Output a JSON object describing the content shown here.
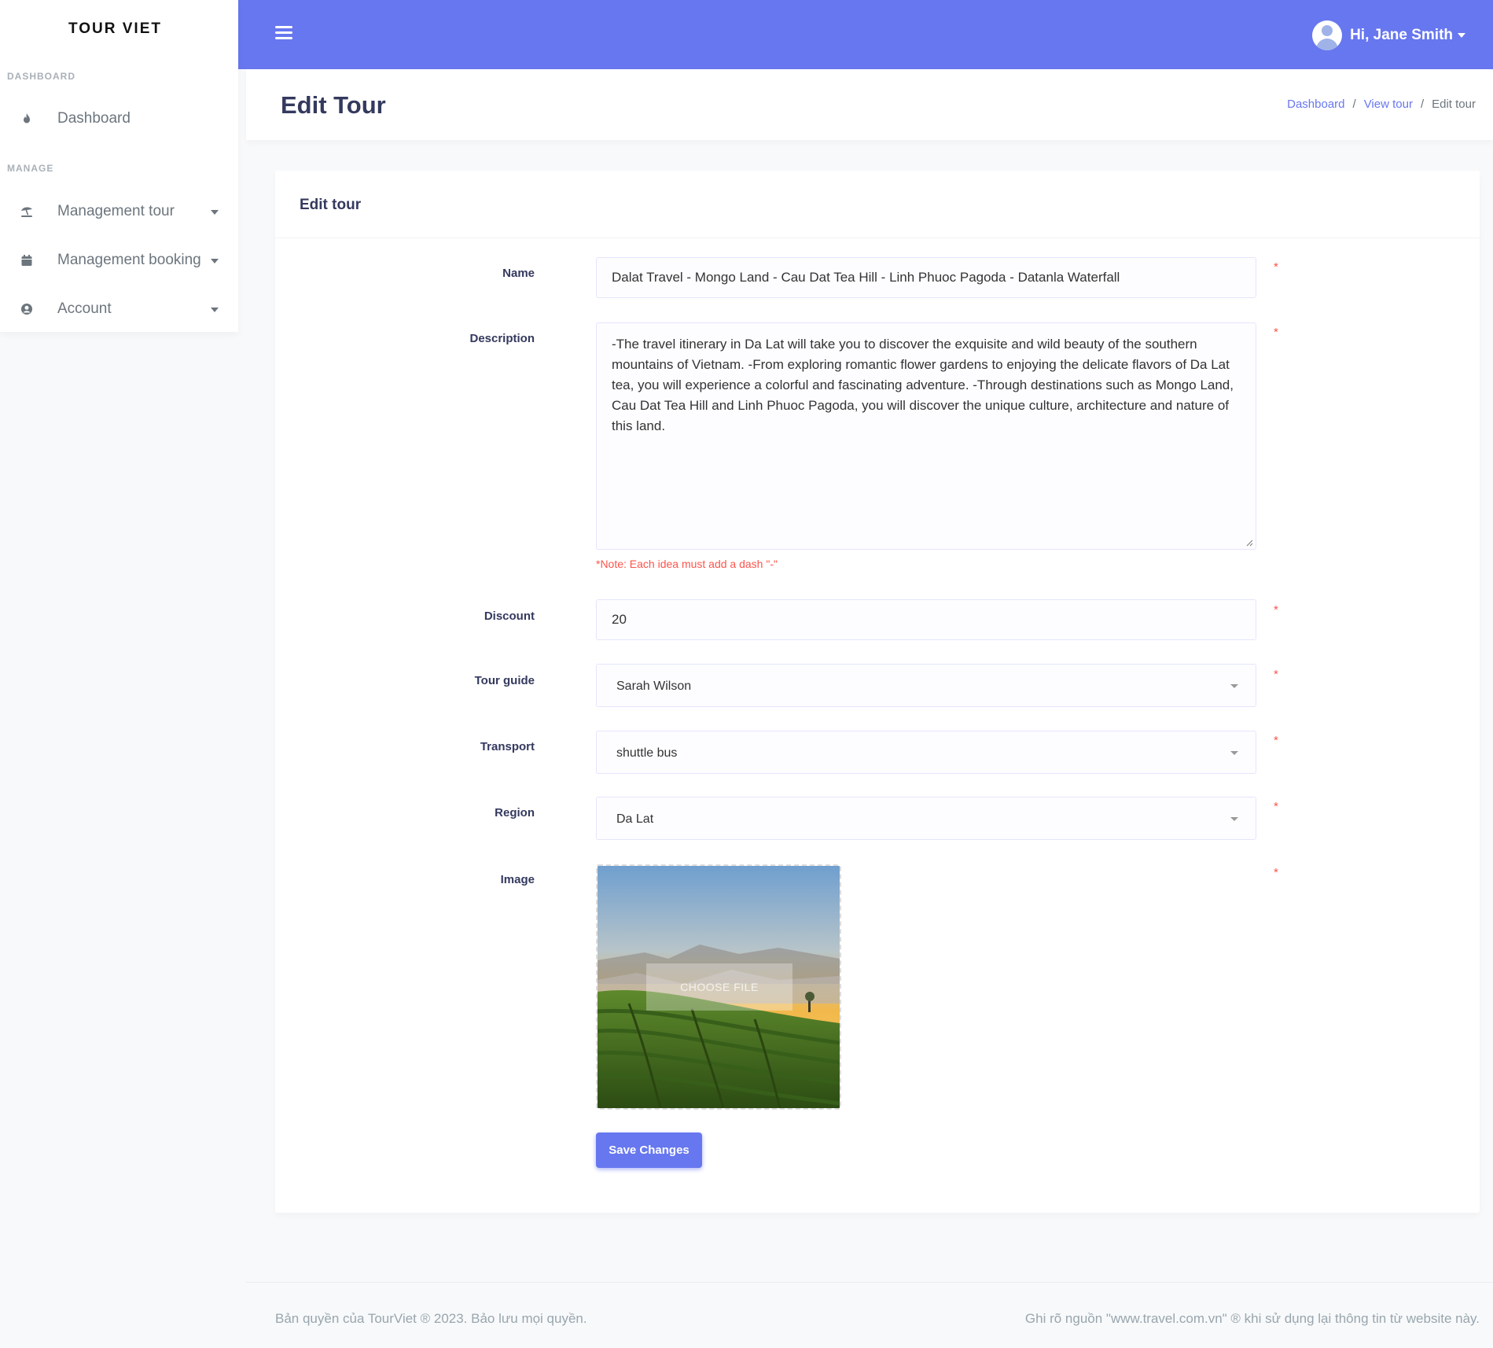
{
  "topbar": {
    "user_greeting": "Hi, Jane Smith"
  },
  "sidebar": {
    "brand": "TOUR VIET",
    "headers": [
      "DASHBOARD",
      "MANAGE"
    ],
    "items": [
      {
        "label": "Dashboard",
        "icon": "fire-icon"
      },
      {
        "label": "Management tour",
        "icon": "beach-umbrella-icon"
      },
      {
        "label": "Management booking",
        "icon": "calendar-icon"
      },
      {
        "label": "Account",
        "icon": "user-circle-icon"
      }
    ]
  },
  "page": {
    "title": "Edit Tour",
    "breadcrumb": [
      "Dashboard",
      "View tour",
      "Edit tour"
    ]
  },
  "card": {
    "title": "Edit tour"
  },
  "form": {
    "name_label": "Name",
    "name_value": "Dalat Travel - Mongo Land - Cau Dat Tea Hill - Linh Phuoc Pagoda - Datanla Waterfall",
    "description_label": "Description",
    "description_value": "-The travel itinerary in Da Lat will take you to discover the exquisite and wild beauty of the southern mountains of Vietnam. -From exploring romantic flower gardens to enjoying the delicate flavors of Da Lat tea, you will experience a colorful and fascinating adventure. -Through destinations such as Mongo Land, Cau Dat Tea Hill and Linh Phuoc Pagoda, you will discover the unique culture, architecture and nature of this land.",
    "description_note": "*Note: Each idea must add a dash \"-\"",
    "discount_label": "Discount",
    "discount_value": "20",
    "tour_guide_label": "Tour guide",
    "tour_guide_value": "Sarah Wilson",
    "transport_label": "Transport",
    "transport_value": "shuttle bus",
    "region_label": "Region",
    "region_value": "Da Lat",
    "image_label": "Image",
    "choose_file_label": "CHOOSE FILE",
    "required_mark": "*",
    "save_label": "Save Changes"
  },
  "footer": {
    "left": "Bản quyền của TourViet ® 2023. Bảo lưu mọi quyền.",
    "right": "Ghi rõ nguồn \"www.travel.com.vn\" ® khi sử dụng lại thông tin từ website này."
  },
  "colors": {
    "primary": "#6777ef",
    "danger": "#fc544b",
    "heading": "#34395e",
    "muted": "#98a6ad"
  }
}
